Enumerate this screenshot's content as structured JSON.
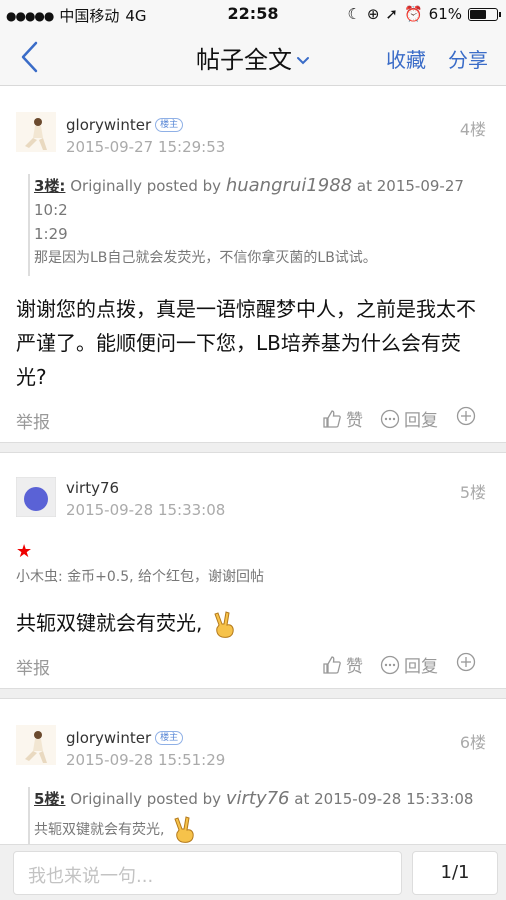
{
  "status_bar": {
    "carrier": "中国移动",
    "network": "4G",
    "time": "22:58",
    "battery": "61%",
    "battery_level": 0.61
  },
  "nav": {
    "title": "帖子全文",
    "favorite": "收藏",
    "share": "分享"
  },
  "posts": [
    {
      "username": "glorywinter",
      "badge": "楼主",
      "date": "2015-09-27 15:29:53",
      "floor": "4楼",
      "quote": {
        "floor": "3楼:",
        "prefix": "Originally posted by",
        "user": "huangrui1988",
        "at": "at 2015-09-27 10:2",
        "at2": "1:29",
        "text": "那是因为LB自己就会发荧光，不信你拿灭菌的LB试试。"
      },
      "content": "谢谢您的点拨，真是一语惊醒梦中人，之前是我太不严谨了。能顺便问一下您，LB培养基为什么会有荧光?",
      "report": "举报",
      "like": "赞",
      "reply": "回复"
    },
    {
      "username": "virty76",
      "date": "2015-09-28 15:33:08",
      "floor": "5楼",
      "reward_star": "★",
      "reward": "小木虫: 金币+0.5, 给个红包，谢谢回帖",
      "content": "共轭双键就会有荧光,",
      "report": "举报",
      "like": "赞",
      "reply": "回复"
    },
    {
      "username": "glorywinter",
      "badge": "楼主",
      "date": "2015-09-28 15:51:29",
      "floor": "6楼",
      "quote": {
        "floor": "5楼:",
        "prefix": "Originally posted by",
        "user": "virty76",
        "at": "at 2015-09-28 15:33:08",
        "text": "共轭双键就会有荧光,"
      }
    }
  ],
  "bottom": {
    "placeholder": "我也来说一句...",
    "page": "1/1"
  }
}
